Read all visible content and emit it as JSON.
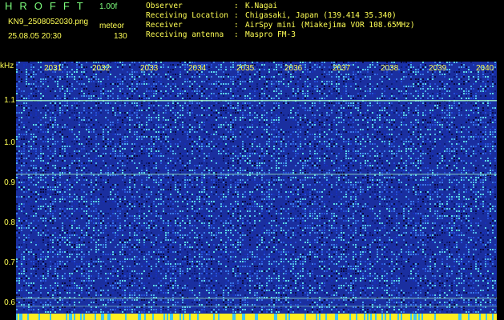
{
  "header": {
    "brand": "HROFFT",
    "version": "1.00f",
    "filename": "KN9_2508052030.png",
    "mode": "meteor",
    "datetime": "25.08.05 20:30",
    "count": "130"
  },
  "info": [
    {
      "label": "Observer",
      "value": "K.Nagai"
    },
    {
      "label": "Receiving Location",
      "value": "Chigasaki, Japan (139.414 35.340)"
    },
    {
      "label": "Receiver",
      "value": "AirSpy mini (Miakejima VOR 108.65MHz)"
    },
    {
      "label": "Receiving antenna",
      "value": "Maspro FM-3"
    }
  ],
  "yaxis": {
    "unit": "kHz",
    "labels": [
      "1.1",
      "1.0",
      "0.9",
      "0.8",
      "0.7",
      "0.6"
    ]
  },
  "xaxis": {
    "labels": [
      "2031",
      "2032",
      "2033",
      "2034",
      "2035",
      "2036",
      "2037",
      "2038",
      "2039",
      "2040"
    ]
  },
  "colors": {
    "background": "#000000",
    "label": "#ffff55",
    "brand": "#7dff7d",
    "noise_dark": "#1a2fa0",
    "noise_light": "#5ad8e8",
    "signal_line": "#9ff0c8",
    "bottom_bar": "#ffee22"
  }
}
